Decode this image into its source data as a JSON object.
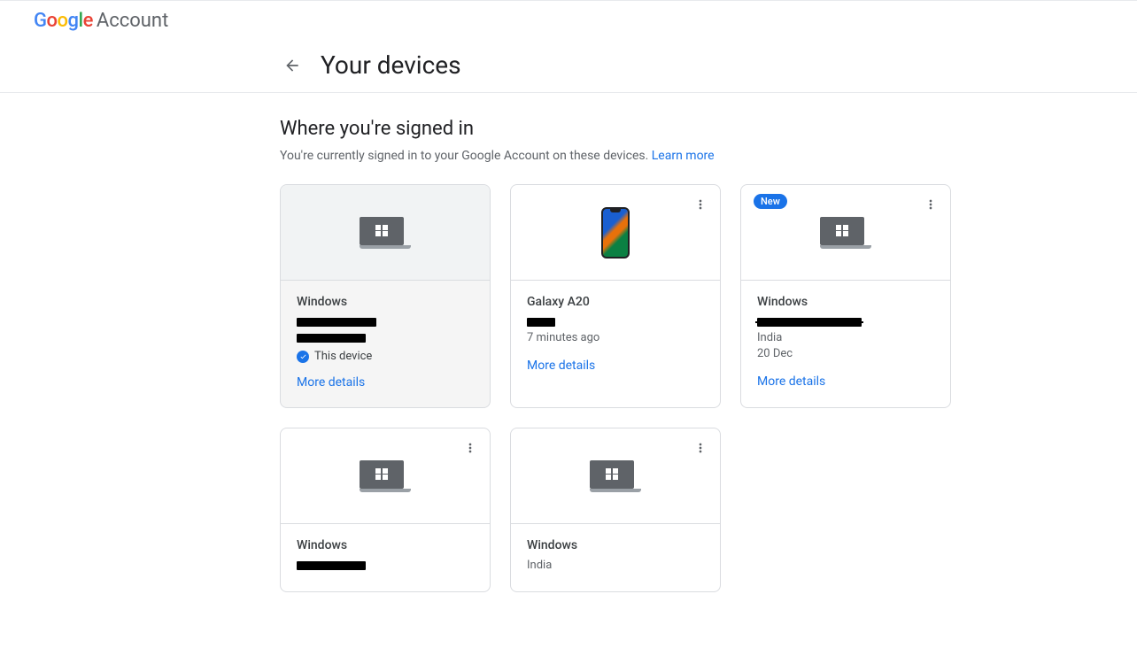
{
  "header": {
    "brand_account": "Account"
  },
  "toolbar": {
    "page_title": "Your devices"
  },
  "section": {
    "title": "Where you're signed in",
    "desc": "You're currently signed in to your Google Account on these devices. ",
    "learn_more": "Learn more"
  },
  "devices": [
    {
      "name": "Windows",
      "this_device_label": "This device",
      "more": "More details"
    },
    {
      "name": "Galaxy A20",
      "time": "7 minutes ago",
      "more": "More details"
    },
    {
      "name": "Windows",
      "badge": "New",
      "loc": "India",
      "date": "20 Dec",
      "more": "More details"
    },
    {
      "name": "Windows"
    },
    {
      "name": "Windows",
      "loc": "India"
    }
  ]
}
